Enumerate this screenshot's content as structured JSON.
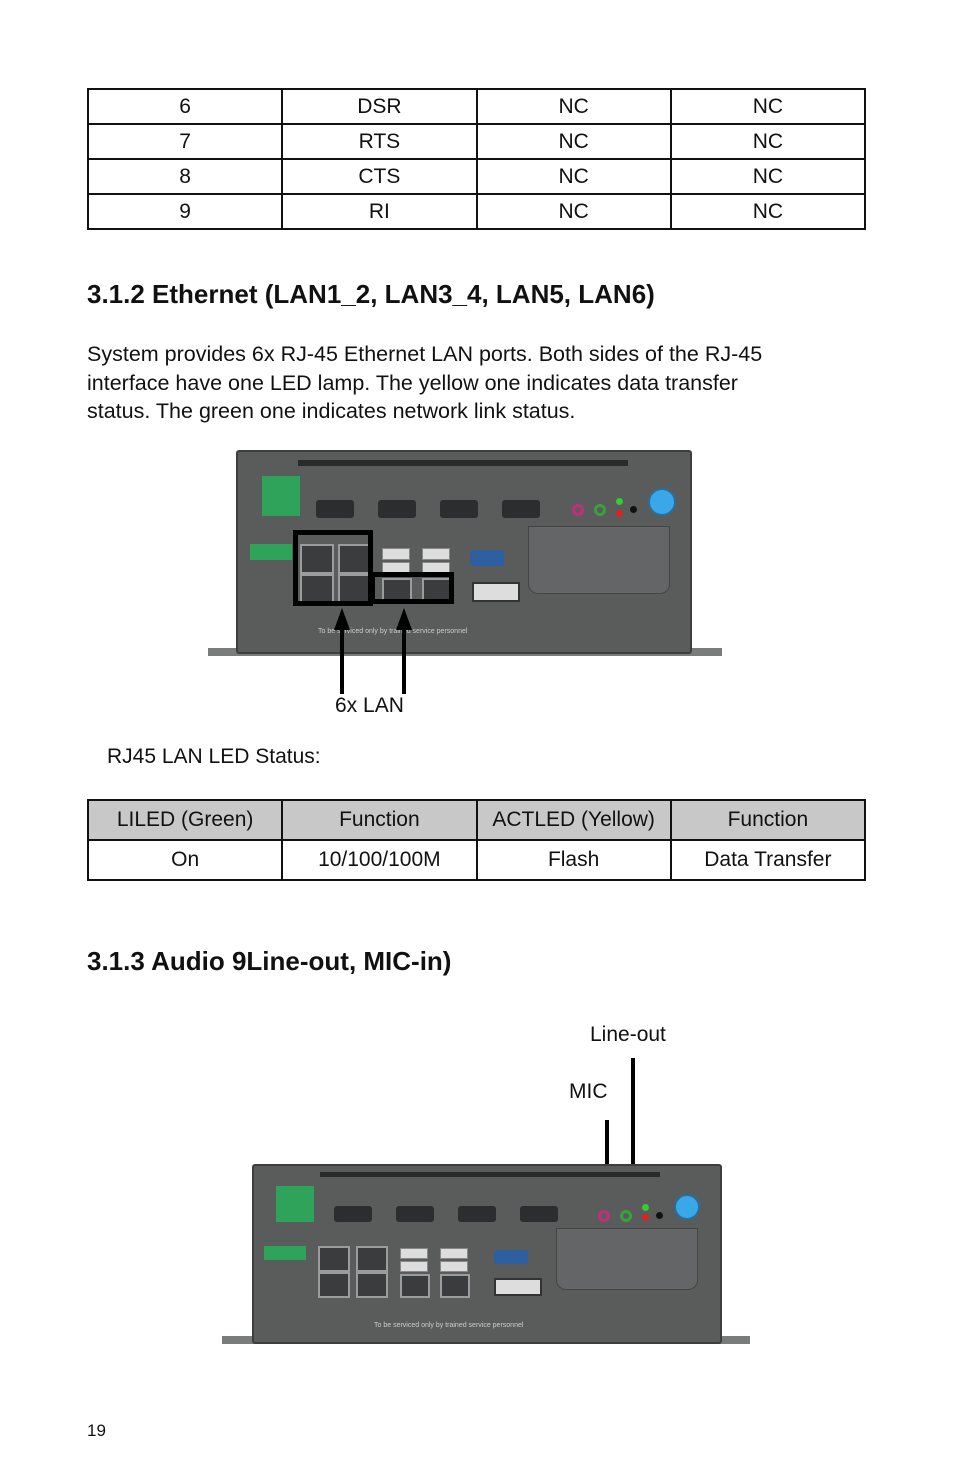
{
  "pin_table": {
    "rows": [
      [
        "6",
        "DSR",
        "NC",
        "NC"
      ],
      [
        "7",
        "RTS",
        "NC",
        "NC"
      ],
      [
        "8",
        "CTS",
        "NC",
        "NC"
      ],
      [
        "9",
        "RI",
        "NC",
        "NC"
      ]
    ]
  },
  "section_ethernet": {
    "heading": "3.1.2 Ethernet (LAN1_2, LAN3_4, LAN5, LAN6)",
    "paragraph_lines": [
      "System provides 6x RJ-45 Ethernet LAN ports. Both sides of the RJ-45",
      "interface have one LED lamp. The yellow one indicates data transfer",
      "status. The green one indicates network link status."
    ],
    "figure_label": "6x LAN",
    "device_warning": "To be serviced only by trained service personnel",
    "led_status_caption": "RJ45 LAN LED Status:"
  },
  "led_table": {
    "headers": [
      "LILED (Green)",
      "Function",
      "ACTLED (Yellow)",
      "Function"
    ],
    "rows": [
      [
        "On",
        "10/100/100M",
        "Flash",
        "Data Transfer"
      ]
    ]
  },
  "section_audio": {
    "heading": "3.1.3 Audio 9Line-out, MIC-in)",
    "line_out_label": "Line-out",
    "mic_label": "MIC"
  },
  "colors": {
    "header_fill": "#c8c8c8",
    "device_body": "#5a5c5c",
    "terminal_green": "#2fa35a",
    "power_button_blue": "#3aa8e8",
    "mic_pink": "#c0307a",
    "lineout_green": "#3aa040"
  },
  "page_number": "19"
}
